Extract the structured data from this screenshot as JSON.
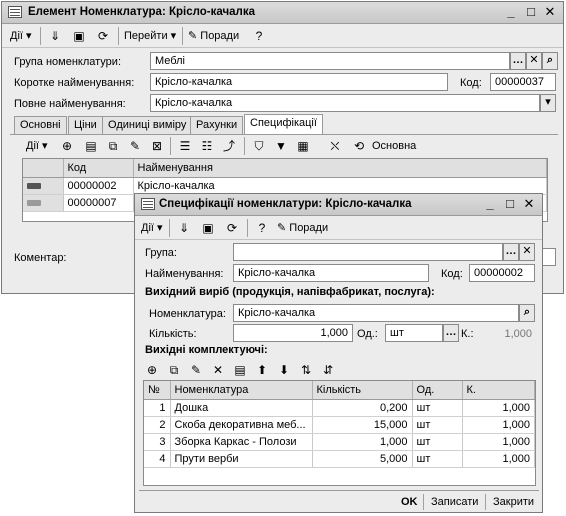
{
  "main": {
    "title": "Елемент Номенклатура: Крісло-качалка",
    "toolbar": {
      "actions": "Дії",
      "goto": "Перейти",
      "hints": "Поради"
    },
    "group_label": "Група номенклатури:",
    "group_value": "Меблі",
    "short_name_label": "Коротке найменування:",
    "short_name_value": "Крісло-качалка",
    "code_label": "Код:",
    "code_value": "00000037",
    "full_name_label": "Повне найменування:",
    "full_name_value": "Крісло-качалка",
    "tabs": [
      "Основні",
      "Ціни",
      "Одиниці виміру",
      "Рахунки",
      "Специфікації"
    ],
    "spec_toolbar": {
      "actions": "Дії",
      "main": "Основна"
    },
    "grid": {
      "headers": [
        "Код",
        "Найменування"
      ],
      "rows": [
        {
          "code": "00000002",
          "name": "Крісло-качалка"
        },
        {
          "code": "00000007",
          "name": ""
        }
      ]
    },
    "comment_label": "Коментар:"
  },
  "spec": {
    "title": "Специфікації номенклатури: Крісло-качалка",
    "toolbar": {
      "actions": "Дії",
      "hints": "Поради"
    },
    "group_label": "Група:",
    "group_value": "",
    "name_label": "Найменування:",
    "name_value": "Крісло-качалка",
    "code_label": "Код:",
    "code_value": "00000002",
    "output_section": "Вихідний виріб (продукція, напівфабрикат, послуга):",
    "nom_label": "Номенклатура:",
    "nom_value": "Крісло-качалка",
    "qty_label": "Кількість:",
    "qty_value": "1,000",
    "unit_label": "Од.:",
    "unit_value": "шт",
    "k_label": "К.:",
    "k_value": "1,000",
    "components_section": "Вихідні комплектуючі:",
    "grid": {
      "headers": [
        "№",
        "Номенклатура",
        "Кількість",
        "Од.",
        "К."
      ],
      "rows": [
        {
          "n": "1",
          "name": "Дошка",
          "qty": "0,200",
          "unit": "шт",
          "k": "1,000"
        },
        {
          "n": "2",
          "name": "Скоба декоративна меб...",
          "qty": "15,000",
          "unit": "шт",
          "k": "1,000"
        },
        {
          "n": "3",
          "name": "Зборка Каркас - Полози",
          "qty": "1,000",
          "unit": "шт",
          "k": "1,000"
        },
        {
          "n": "4",
          "name": "Прути верби",
          "qty": "5,000",
          "unit": "шт",
          "k": "1,000"
        }
      ]
    },
    "buttons": {
      "ok": "OK",
      "save": "Записати",
      "close": "Закрити"
    }
  }
}
